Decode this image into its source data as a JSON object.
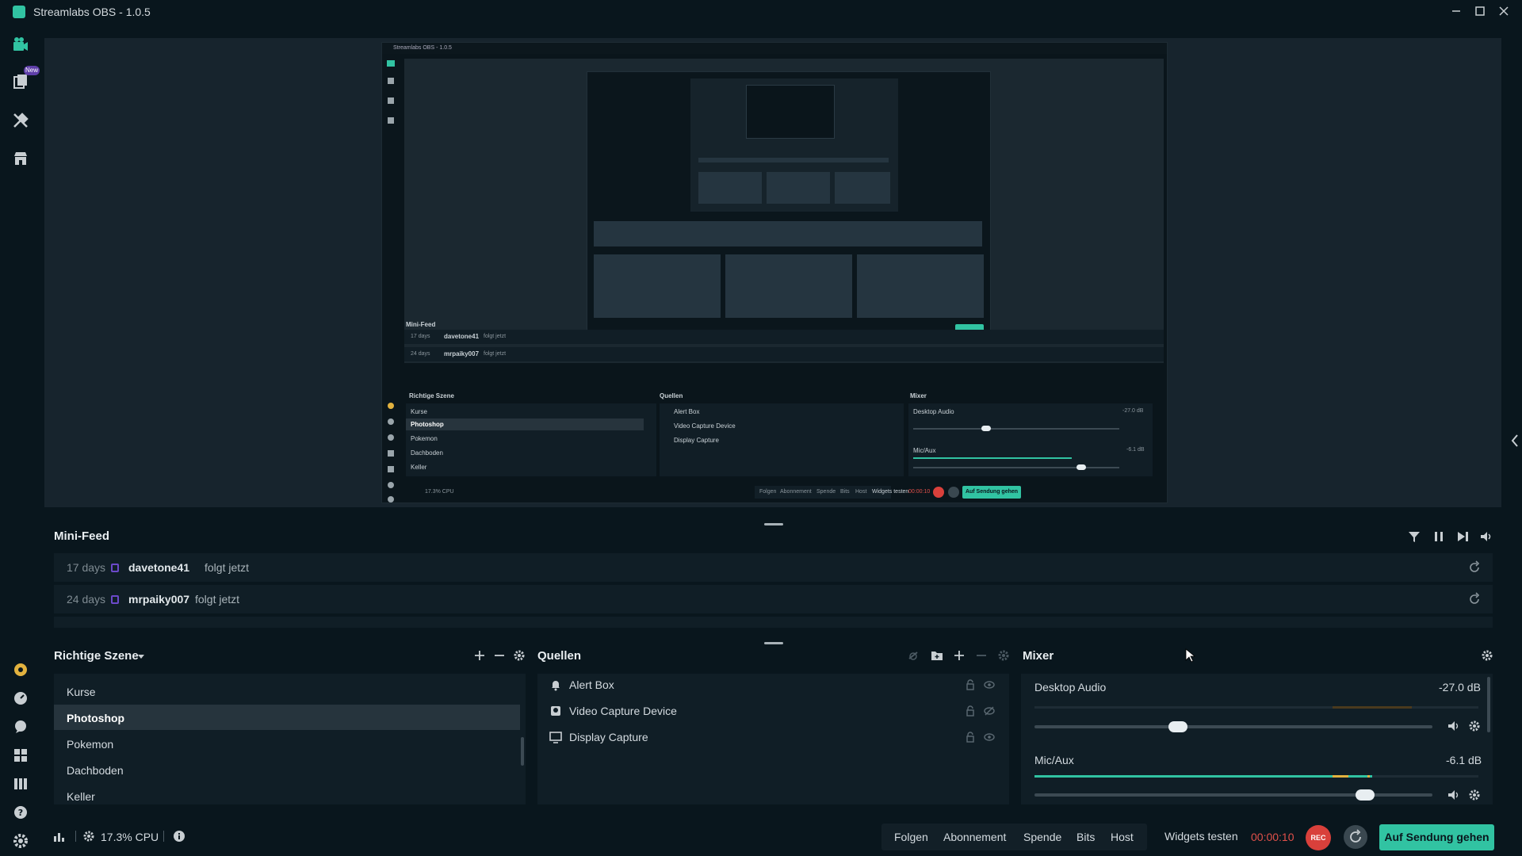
{
  "window": {
    "title": "Streamlabs OBS - 1.0.5"
  },
  "nav": {
    "new_badge": "New"
  },
  "preview_inner": {
    "title": "Streamlabs OBS - 1.0.5",
    "minifeed_title": "Mini-Feed",
    "feed": [
      {
        "time": "17 days",
        "user": "davetone41",
        "action": "folgt jetzt"
      },
      {
        "time": "24 days",
        "user": "mrpaiky007",
        "action": "folgt jetzt"
      }
    ],
    "scenes_title": "Richtige Szene",
    "scenes": [
      "Kurse",
      "Photoshop",
      "Pokemon",
      "Dachboden",
      "Keller"
    ],
    "sources_title": "Quellen",
    "sources": [
      "Alert Box",
      "Video Capture Device",
      "Display Capture"
    ],
    "mixer_title": "Mixer",
    "desktop_audio": "Desktop Audio",
    "desktop_db": "-27.0 dB",
    "mic": "Mic/Aux",
    "mic_db": "-6.1 dB",
    "cpu": "17.3% CPU",
    "footer_buttons": [
      "Folgen",
      "Abonnement",
      "Spende",
      "Bits",
      "Host"
    ],
    "widgets": "Widgets testen",
    "timer": "00:00:10",
    "golive": "Auf Sendung gehen"
  },
  "minifeed": {
    "title": "Mini-Feed",
    "rows": [
      {
        "time": "17 days",
        "user": "davetone41",
        "action": "folgt jetzt"
      },
      {
        "time": "24 days",
        "user": "mrpaiky007",
        "action": "folgt jetzt"
      }
    ]
  },
  "scenes": {
    "title": "Richtige Szene",
    "items": [
      "Kurse",
      "Photoshop",
      "Pokemon",
      "Dachboden",
      "Keller"
    ],
    "active_index": 1
  },
  "sources": {
    "title": "Quellen",
    "items": [
      {
        "label": "Alert Box",
        "icon": "bell-icon"
      },
      {
        "label": "Video Capture Device",
        "icon": "webcam-icon"
      },
      {
        "label": "Display Capture",
        "icon": "monitor-icon"
      }
    ]
  },
  "mixer": {
    "title": "Mixer",
    "channels": [
      {
        "name": "Desktop Audio",
        "db": "-27.0 dB",
        "volume": 0.36,
        "level": 0.0
      },
      {
        "name": "Mic/Aux",
        "db": "-6.1 dB",
        "volume": 0.83,
        "level": 0.76
      }
    ]
  },
  "footer": {
    "cpu": "17.3% CPU",
    "buttons": [
      "Folgen",
      "Abonnement",
      "Spende",
      "Bits",
      "Host"
    ],
    "widgets": "Widgets testen",
    "timer": "00:00:10",
    "rec": "REC",
    "golive": "Auf Sendung gehen"
  },
  "colors": {
    "accent": "#31c3a2",
    "rec": "#d9403b",
    "timer": "#e0504a",
    "bg": "#09161d",
    "panel": "#101e26"
  }
}
